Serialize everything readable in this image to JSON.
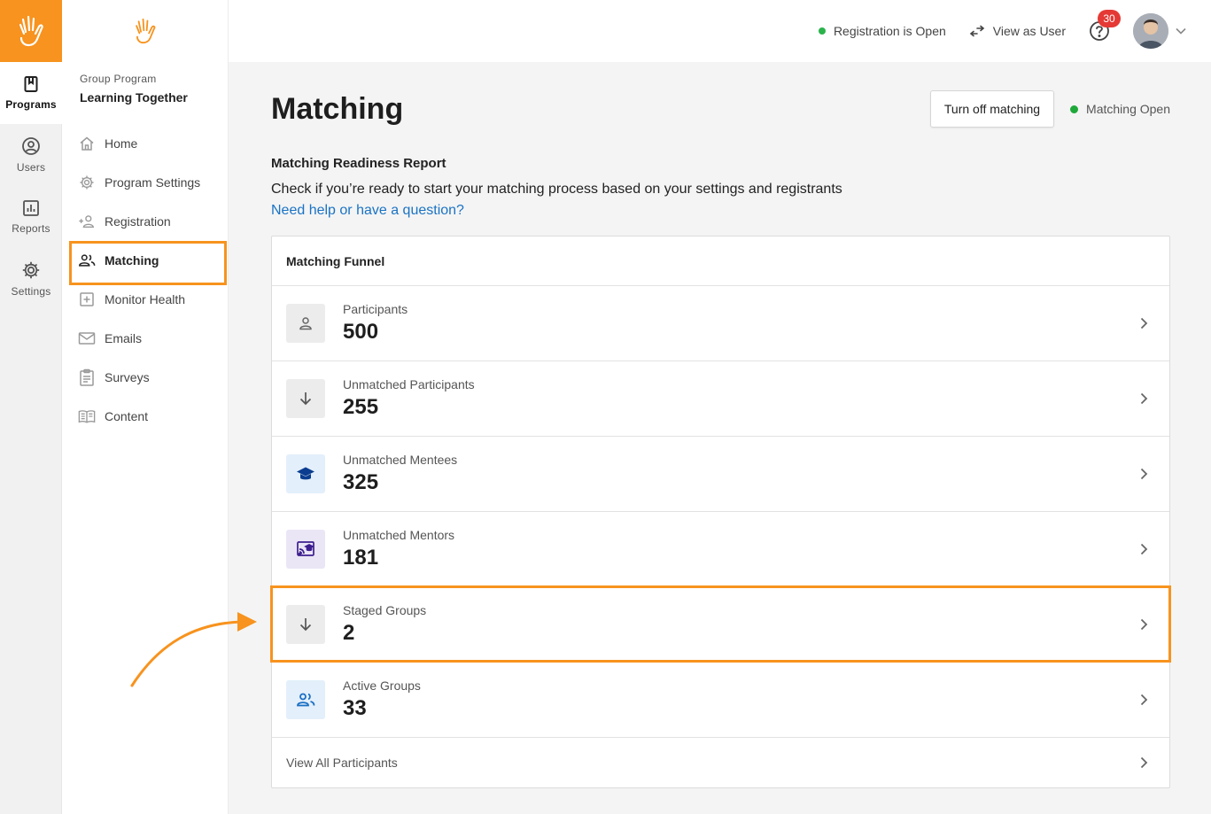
{
  "rail": {
    "items": [
      {
        "label": "Programs",
        "icon": "book-icon",
        "active": true
      },
      {
        "label": "Users",
        "icon": "user-circle-icon",
        "active": false
      },
      {
        "label": "Reports",
        "icon": "bar-chart-icon",
        "active": false
      },
      {
        "label": "Settings",
        "icon": "gear-icon",
        "active": false
      }
    ]
  },
  "sidebar": {
    "kicker": "Group Program",
    "program_name": "Learning Together",
    "items": [
      {
        "label": "Home",
        "icon": "home-icon"
      },
      {
        "label": "Program Settings",
        "icon": "gear-icon"
      },
      {
        "label": "Registration",
        "icon": "person-add-icon"
      },
      {
        "label": "Matching",
        "icon": "people-icon",
        "active": true
      },
      {
        "label": "Monitor Health",
        "icon": "plus-box-icon"
      },
      {
        "label": "Emails",
        "icon": "mail-icon"
      },
      {
        "label": "Surveys",
        "icon": "clipboard-icon"
      },
      {
        "label": "Content",
        "icon": "open-book-icon"
      }
    ]
  },
  "topbar": {
    "registration_status": "Registration is Open",
    "view_as_user": "View as User",
    "help_badge": "30"
  },
  "main": {
    "title": "Matching",
    "turn_off_button": "Turn off matching",
    "status": "Matching Open",
    "report_title": "Matching Readiness Report",
    "report_desc": "Check if you’re ready to start your matching process based on your settings and registrants",
    "help_link": "Need help or have a question?",
    "funnel": {
      "title": "Matching Funnel",
      "rows": [
        {
          "label": "Participants",
          "value": "500",
          "icon": "person-icon"
        },
        {
          "label": "Unmatched Participants",
          "value": "255",
          "icon": "arrow-down-icon"
        },
        {
          "label": "Unmatched Mentees",
          "value": "325",
          "icon": "graduation-cap-icon"
        },
        {
          "label": "Unmatched Mentors",
          "value": "181",
          "icon": "mentor-board-icon"
        },
        {
          "label": "Staged Groups",
          "value": "2",
          "icon": "arrow-down-icon"
        },
        {
          "label": "Active Groups",
          "value": "33",
          "icon": "people-icon"
        }
      ],
      "footer": "View All Participants"
    }
  },
  "colors": {
    "brand_orange": "#f7931e",
    "status_green": "#1fa83a",
    "link_blue": "#1a73c4",
    "badge_red": "#e53935"
  }
}
